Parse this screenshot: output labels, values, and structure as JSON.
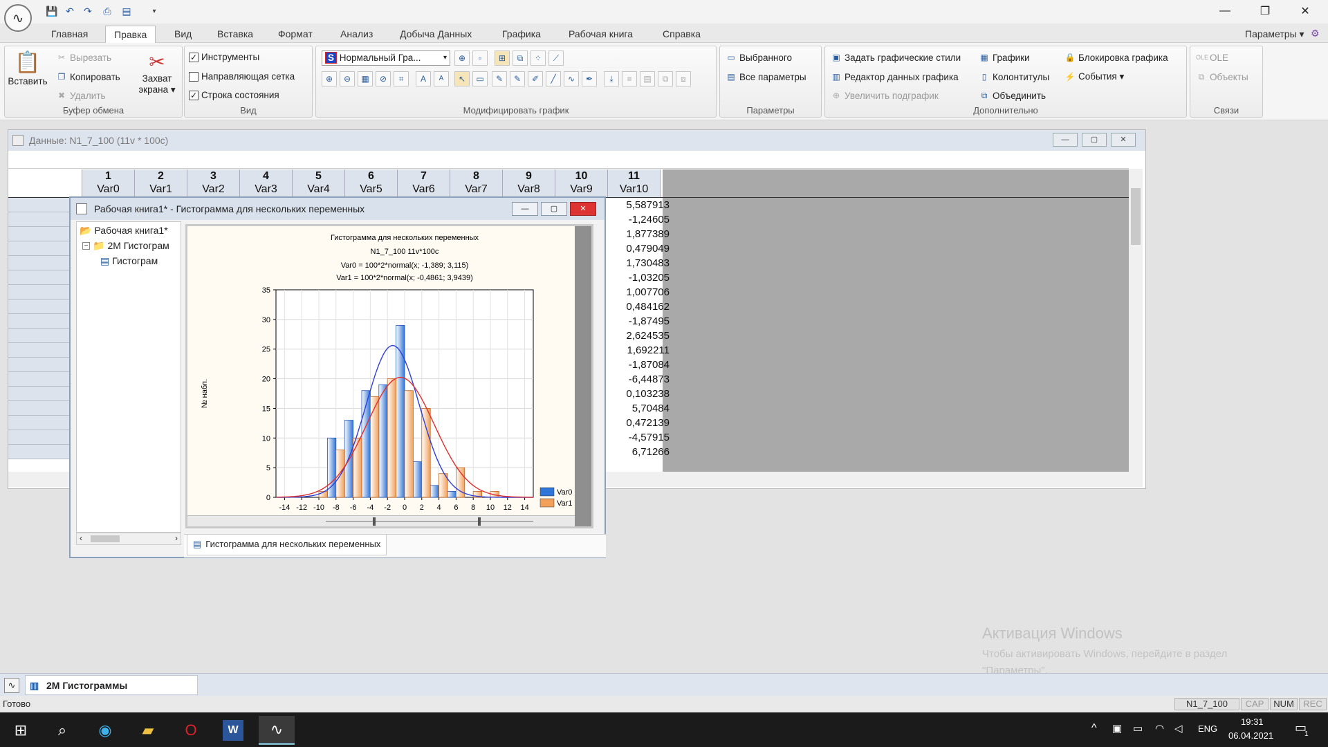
{
  "app": {
    "window_controls": {
      "minimize": "—",
      "restore": "❐",
      "close": "✕"
    }
  },
  "menu": {
    "tabs": [
      "Главная",
      "Правка",
      "Вид",
      "Вставка",
      "Формат",
      "Анализ",
      "Добыча Данных",
      "Графика",
      "Рабочая книга",
      "Справка"
    ],
    "active": "Правка",
    "params_label": "Параметры ▾"
  },
  "ribbon": {
    "clipboard": {
      "label": "Буфер обмена",
      "paste": "Вставить",
      "cut": "Вырезать",
      "copy": "Копировать",
      "delete": "Удалить",
      "capture": "Захват экрана ▾"
    },
    "view": {
      "label": "Вид",
      "tools": "Инструменты",
      "tools_checked": true,
      "grid": "Направляющая сетка",
      "grid_checked": false,
      "status": "Строка состояния",
      "status_checked": true
    },
    "modify": {
      "label": "Модифицировать график",
      "style_select": "Нормальный Гра..."
    },
    "params": {
      "label": "Параметры",
      "selected": "Выбранного",
      "all": "Все параметры"
    },
    "extra": {
      "label": "Дополнительно",
      "set_styles": "Задать графические стили",
      "editor": "Редактор данных графика",
      "zoom_sub": "Увеличить подграфик",
      "graphs": "Графики",
      "headers": "Колонтитулы",
      "merge": "Объединить",
      "lock": "Блокировка графика",
      "events": "События ▾"
    },
    "links": {
      "label": "Связи",
      "ole": "OLE",
      "objects": "Объекты"
    }
  },
  "datawin": {
    "title": "Данные: N1_7_100 (11v * 100c)",
    "columns": [
      {
        "n": "1",
        "v": "Var0"
      },
      {
        "n": "2",
        "v": "Var1"
      },
      {
        "n": "3",
        "v": "Var2"
      },
      {
        "n": "4",
        "v": "Var3"
      },
      {
        "n": "5",
        "v": "Var4"
      },
      {
        "n": "6",
        "v": "Var5"
      },
      {
        "n": "7",
        "v": "Var6"
      },
      {
        "n": "8",
        "v": "Var7"
      },
      {
        "n": "9",
        "v": "Var8"
      },
      {
        "n": "10",
        "v": "Var9"
      },
      {
        "n": "11",
        "v": "Var10"
      }
    ],
    "var10_values": [
      "5,587913",
      "-1,24605",
      "1,877389",
      "0,479049",
      "1,730483",
      "-1,03205",
      "1,007706",
      "0,484162",
      "-1,87495",
      "2,624535",
      "1,692211",
      "-1,87084",
      "-6,44873",
      "0,103238",
      "5,70484",
      "0,472139",
      "-4,57915",
      "6,71266"
    ]
  },
  "bookwin": {
    "title": "Рабочая книга1* - Гистограмма для нескольких переменных",
    "tree": {
      "root": "Рабочая книга1*",
      "folder": "2М Гистограм",
      "leaf": "Гистограм"
    },
    "tab_label": "Гистограмма для нескольких переменных"
  },
  "chart_data": {
    "type": "bar",
    "title": "Гистограмма для нескольких переменных",
    "subtitle": "N1_7_100 11v*100c",
    "formula0": "Var0 = 100*2*normal(x; -1,389; 3,115)",
    "formula1": "Var1 = 100*2*normal(x; -0,4861; 3,9439)",
    "ylabel": "№ набл.",
    "ylim": [
      0,
      35
    ],
    "xlim": [
      -15,
      15
    ],
    "yticks": [
      "0",
      "5",
      "10",
      "15",
      "20",
      "25",
      "30",
      "35"
    ],
    "xticks": [
      "-14",
      "-12",
      "-10",
      "-8",
      "-6",
      "-4",
      "-2",
      "0",
      "2",
      "4",
      "6",
      "8",
      "10",
      "12",
      "14"
    ],
    "x": [
      -14,
      -12,
      -10,
      -8,
      -6,
      -4,
      -2,
      0,
      2,
      4,
      6,
      8,
      10,
      12
    ],
    "series": [
      {
        "name": "Var0",
        "color": "#2f74d8",
        "values": [
          0,
          0,
          0,
          10,
          13,
          18,
          19,
          29,
          6,
          2,
          1,
          0,
          0,
          0
        ],
        "curve_mean": -1.389,
        "curve_sd": 3.115,
        "curve_color": "#2f3fd6"
      },
      {
        "name": "Var1",
        "color": "#f2a05a",
        "values": [
          0,
          0,
          1,
          8,
          10,
          17,
          20,
          18,
          15,
          4,
          5,
          1,
          1,
          0
        ],
        "curve_mean": -0.4861,
        "curve_sd": 3.9439,
        "curve_color": "#e02e2e"
      }
    ],
    "legend": "bottom-right",
    "grid": true
  },
  "taskstrip": {
    "item": "2М Гистограммы"
  },
  "status": {
    "ready": "Готово",
    "file": "N1_7_100",
    "cap": "CAP",
    "num": "NUM",
    "rec": "REC"
  },
  "watermark": {
    "title": "Активация Windows",
    "line1": "Чтобы активировать Windows, перейдите в раздел",
    "line2": "\"Параметры\"."
  },
  "taskbar": {
    "lang": "ENG",
    "time": "19:31",
    "date": "06.04.2021",
    "notif": "1"
  }
}
